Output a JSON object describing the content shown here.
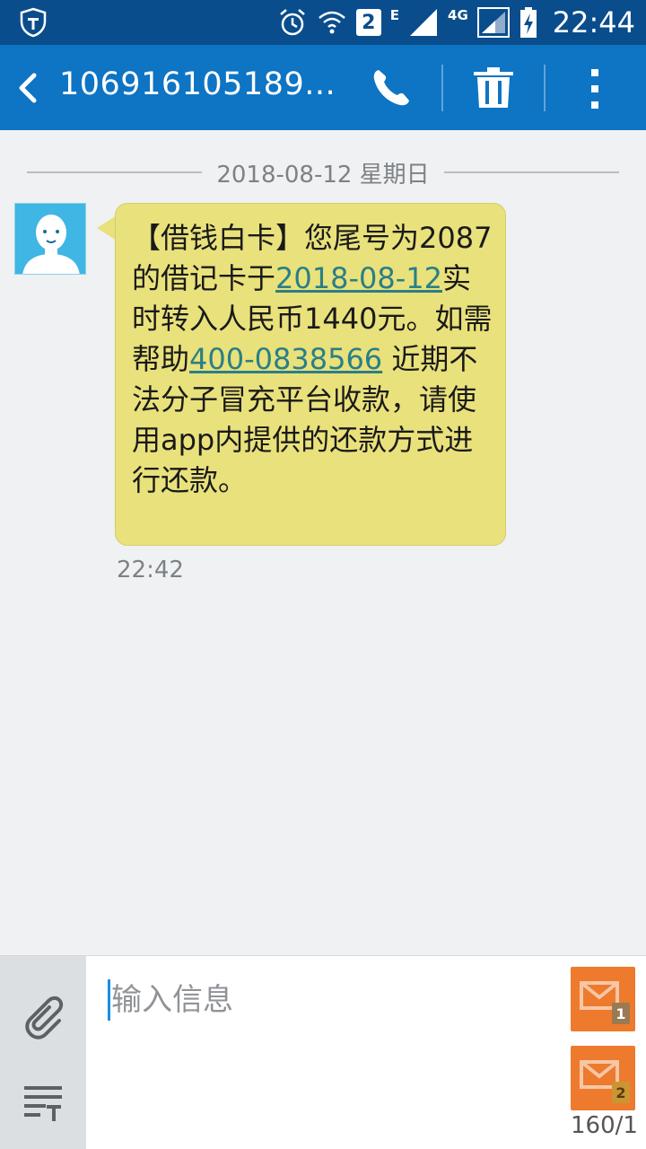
{
  "status_bar": {
    "sim_badge": "2",
    "network_e": "E",
    "network_4g": "4G",
    "time": "22:44"
  },
  "action_bar": {
    "title": "106916105189..."
  },
  "conversation": {
    "date_label": "2018-08-12 星期日",
    "message": {
      "text_1": "【借钱白卡】您尾号为2087的借记卡于",
      "date_link": "2018-08-12",
      "text_2": "实时转入人民币1440元。如需帮助",
      "phone_link": "400-0838566",
      "text_3": " 近期不法分子冒充平台收款，请使用app内提供的还款方式进行还款。",
      "time": "22:42"
    }
  },
  "compose": {
    "placeholder": "输入信息",
    "send_sim1_label": "1",
    "send_sim2_label": "2",
    "char_count": "160/1"
  },
  "colors": {
    "status_bar": "#0a4d8c",
    "action_bar": "#0e74c4",
    "bubble": "#e9e17b",
    "link": "#2a7f86",
    "send_button": "#ee7a2d"
  }
}
